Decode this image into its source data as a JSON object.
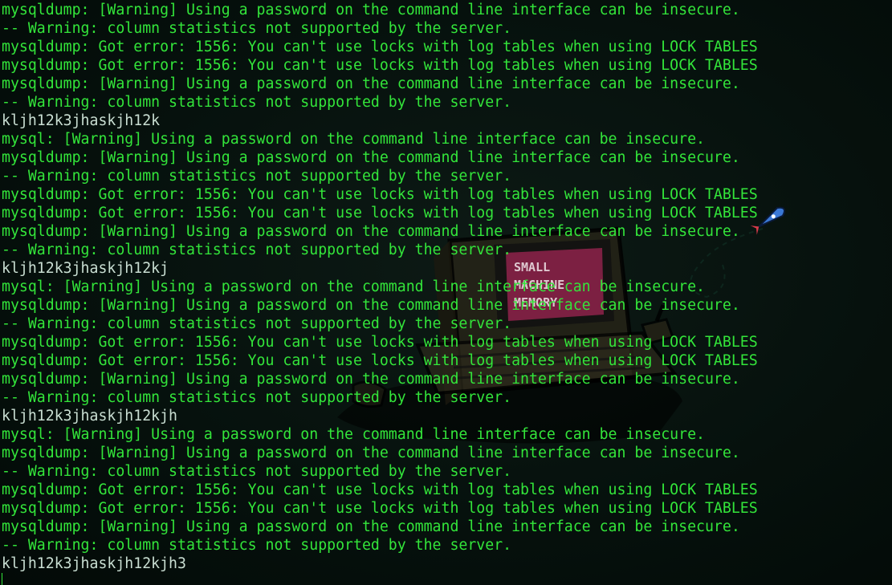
{
  "colors": {
    "background": "#030a07",
    "text_green": "#33e53a",
    "text_plain": "#c9ded2",
    "screen_pink": "#d42c6c"
  },
  "wallpaper": {
    "icons": [
      "computer-illustration-icon",
      "rocket-icon"
    ],
    "screen_text": [
      "SMALL",
      "MACHINE",
      "MEMORY"
    ]
  },
  "terminal": {
    "lines": [
      {
        "text": "mysqldump: [Warning] Using a password on the command line interface can be insecure.",
        "style": "green"
      },
      {
        "text": "-- Warning: column statistics not supported by the server.",
        "style": "green"
      },
      {
        "text": "mysqldump: Got error: 1556: You can't use locks with log tables when using LOCK TABLES",
        "style": "green"
      },
      {
        "text": "mysqldump: Got error: 1556: You can't use locks with log tables when using LOCK TABLES",
        "style": "green"
      },
      {
        "text": "mysqldump: [Warning] Using a password on the command line interface can be insecure.",
        "style": "green"
      },
      {
        "text": "-- Warning: column statistics not supported by the server.",
        "style": "green"
      },
      {
        "text": "kljh12k3jhaskjh12k",
        "style": "plain"
      },
      {
        "text": "mysql: [Warning] Using a password on the command line interface can be insecure.",
        "style": "green"
      },
      {
        "text": "mysqldump: [Warning] Using a password on the command line interface can be insecure.",
        "style": "green"
      },
      {
        "text": "-- Warning: column statistics not supported by the server.",
        "style": "green"
      },
      {
        "text": "mysqldump: Got error: 1556: You can't use locks with log tables when using LOCK TABLES",
        "style": "green"
      },
      {
        "text": "mysqldump: Got error: 1556: You can't use locks with log tables when using LOCK TABLES",
        "style": "green"
      },
      {
        "text": "mysqldump: [Warning] Using a password on the command line interface can be insecure.",
        "style": "green"
      },
      {
        "text": "-- Warning: column statistics not supported by the server.",
        "style": "green"
      },
      {
        "text": "kljh12k3jhaskjh12kj",
        "style": "plain"
      },
      {
        "text": "mysql: [Warning] Using a password on the command line interface can be insecure.",
        "style": "green"
      },
      {
        "text": "mysqldump: [Warning] Using a password on the command line interface can be insecure.",
        "style": "green"
      },
      {
        "text": "-- Warning: column statistics not supported by the server.",
        "style": "green"
      },
      {
        "text": "mysqldump: Got error: 1556: You can't use locks with log tables when using LOCK TABLES",
        "style": "green"
      },
      {
        "text": "mysqldump: Got error: 1556: You can't use locks with log tables when using LOCK TABLES",
        "style": "green"
      },
      {
        "text": "mysqldump: [Warning] Using a password on the command line interface can be insecure.",
        "style": "green"
      },
      {
        "text": "-- Warning: column statistics not supported by the server.",
        "style": "green"
      },
      {
        "text": "kljh12k3jhaskjh12kjh",
        "style": "plain"
      },
      {
        "text": "mysql: [Warning] Using a password on the command line interface can be insecure.",
        "style": "green"
      },
      {
        "text": "mysqldump: [Warning] Using a password on the command line interface can be insecure.",
        "style": "green"
      },
      {
        "text": "-- Warning: column statistics not supported by the server.",
        "style": "green"
      },
      {
        "text": "mysqldump: Got error: 1556: You can't use locks with log tables when using LOCK TABLES",
        "style": "green"
      },
      {
        "text": "mysqldump: Got error: 1556: You can't use locks with log tables when using LOCK TABLES",
        "style": "green"
      },
      {
        "text": "mysqldump: [Warning] Using a password on the command line interface can be insecure.",
        "style": "green"
      },
      {
        "text": "-- Warning: column statistics not supported by the server.",
        "style": "green"
      },
      {
        "text": "kljh12k3jhaskjh12kjh3",
        "style": "plain"
      }
    ]
  }
}
